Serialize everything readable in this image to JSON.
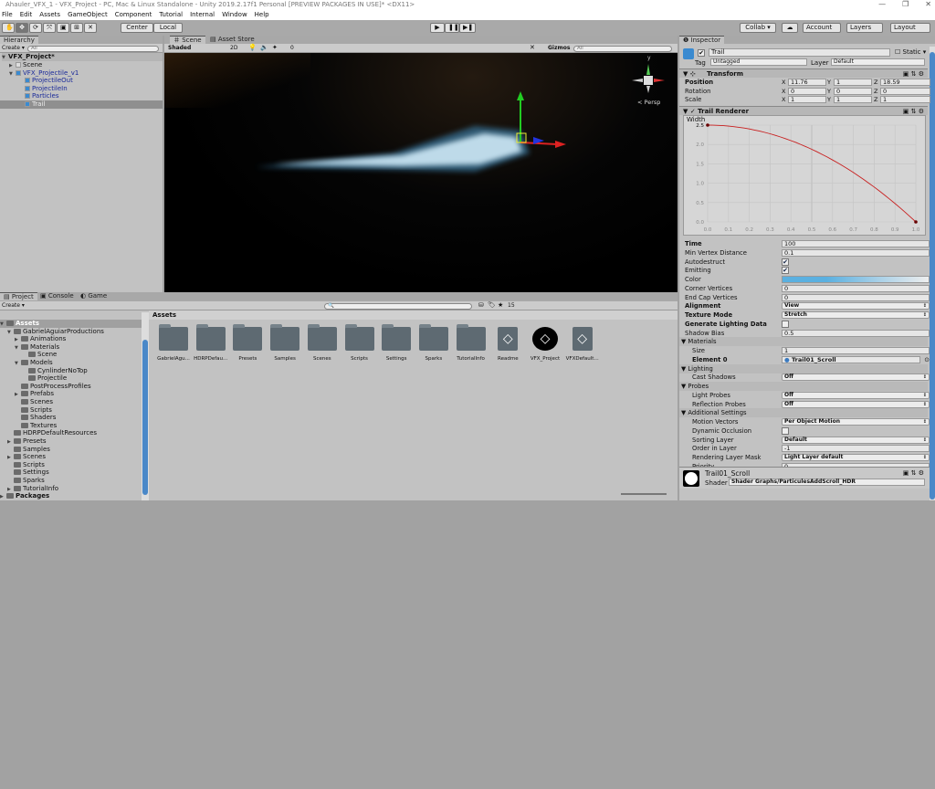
{
  "window": {
    "title": "Ahauler_VFX_1 - VFX_Project - PC, Mac & Linux Standalone - Unity 2019.2.17f1 Personal [PREVIEW PACKAGES IN USE]* <DX11>",
    "minimize": "—",
    "restore": "❐",
    "close": "✕"
  },
  "menu": [
    "File",
    "Edit",
    "Assets",
    "GameObject",
    "Component",
    "Tutorial",
    "Internal",
    "Window",
    "Help"
  ],
  "toolbar": {
    "tools": [
      "hand-tool",
      "move-tool",
      "rotate-tool",
      "scale-tool",
      "rect-tool",
      "transform-tool",
      "custom-tool"
    ],
    "tool_glyphs": [
      "✋",
      "✥",
      "⟳",
      "⤧",
      "▣",
      "⊞",
      "✕"
    ],
    "pivot": "Center",
    "space": "Local",
    "play": "▶",
    "pause": "❚❚",
    "step": "▶❚",
    "collab": "Collab ▾",
    "cloud": "☁",
    "account": "Account",
    "layers": "Layers",
    "layout": "Layout"
  },
  "hierarchy": {
    "tab": "Hierarchy",
    "create": "Create ▾",
    "search": "All",
    "scene": "VFX_Project*",
    "items": [
      {
        "label": "Scene",
        "depth": 1,
        "fold": "▶",
        "blue": false
      },
      {
        "label": "VFX_Projectile_v1",
        "depth": 1,
        "fold": "▼",
        "blue": true
      },
      {
        "label": "ProjectileOut",
        "depth": 2,
        "fold": "",
        "blue": true
      },
      {
        "label": "ProjectileIn",
        "depth": 2,
        "fold": "",
        "blue": true
      },
      {
        "label": "Particles",
        "depth": 2,
        "fold": "",
        "blue": true
      },
      {
        "label": "Trail",
        "depth": 2,
        "fold": "",
        "blue": true,
        "selected": true
      }
    ]
  },
  "scene": {
    "tabs": [
      "Scene",
      "Asset Store"
    ],
    "shading": "Shaded",
    "mode2d": "2D",
    "gizmos": "Gizmos",
    "search": "All",
    "hidden_count": "0",
    "persp": "< Persp",
    "axis_y": "y"
  },
  "project": {
    "tabs": [
      "Project",
      "Console",
      "Game"
    ],
    "create": "Create ▾",
    "breadcrumb": "Assets",
    "hidden_count": "15",
    "tree": [
      {
        "label": "Assets",
        "depth": 0,
        "fold": "▼",
        "bold": true,
        "selected": true
      },
      {
        "label": "GabrielAguiarProductions",
        "depth": 1,
        "fold": "▼"
      },
      {
        "label": "Animations",
        "depth": 2,
        "fold": "▶"
      },
      {
        "label": "Materials",
        "depth": 2,
        "fold": "▼"
      },
      {
        "label": "Scene",
        "depth": 3,
        "fold": ""
      },
      {
        "label": "Models",
        "depth": 2,
        "fold": "▼"
      },
      {
        "label": "CynlinderNoTop",
        "depth": 3,
        "fold": ""
      },
      {
        "label": "Projectile",
        "depth": 3,
        "fold": ""
      },
      {
        "label": "PostProcessProfiles",
        "depth": 2,
        "fold": ""
      },
      {
        "label": "Prefabs",
        "depth": 2,
        "fold": "▶"
      },
      {
        "label": "Scenes",
        "depth": 2,
        "fold": ""
      },
      {
        "label": "Scripts",
        "depth": 2,
        "fold": ""
      },
      {
        "label": "Shaders",
        "depth": 2,
        "fold": ""
      },
      {
        "label": "Textures",
        "depth": 2,
        "fold": ""
      },
      {
        "label": "HDRPDefaultResources",
        "depth": 1,
        "fold": ""
      },
      {
        "label": "Presets",
        "depth": 1,
        "fold": "▶"
      },
      {
        "label": "Samples",
        "depth": 1,
        "fold": ""
      },
      {
        "label": "Scenes",
        "depth": 1,
        "fold": "▶"
      },
      {
        "label": "Scripts",
        "depth": 1,
        "fold": ""
      },
      {
        "label": "Settings",
        "depth": 1,
        "fold": ""
      },
      {
        "label": "Sparks",
        "depth": 1,
        "fold": ""
      },
      {
        "label": "TutorialInfo",
        "depth": 1,
        "fold": "▶"
      },
      {
        "label": "Packages",
        "depth": 0,
        "fold": "▶",
        "bold": true
      }
    ],
    "assets": [
      {
        "label": "GabrielAgu...",
        "type": "folder"
      },
      {
        "label": "HDRPDefau...",
        "type": "folder"
      },
      {
        "label": "Presets",
        "type": "folder"
      },
      {
        "label": "Samples",
        "type": "folder"
      },
      {
        "label": "Scenes",
        "type": "folder"
      },
      {
        "label": "Scripts",
        "type": "folder"
      },
      {
        "label": "Settings",
        "type": "folder"
      },
      {
        "label": "Sparks",
        "type": "folder"
      },
      {
        "label": "TutorialInfo",
        "type": "folder"
      },
      {
        "label": "Readme",
        "type": "unity-asset"
      },
      {
        "label": "VFX_Project",
        "type": "unity-scene"
      },
      {
        "label": "VFXDefault...",
        "type": "unity-asset"
      }
    ]
  },
  "inspector": {
    "tab": "Inspector",
    "name": "Trail",
    "static": "Static",
    "tag_label": "Tag",
    "tag": "Untagged",
    "layer_label": "Layer",
    "layer": "Default",
    "transform": {
      "title": "Transform",
      "rows": [
        {
          "label": "Position",
          "x": "11.76",
          "y": "1",
          "z": "18.59"
        },
        {
          "label": "Rotation",
          "x": "0",
          "y": "0",
          "z": "0"
        },
        {
          "label": "Scale",
          "x": "1",
          "y": "1",
          "z": "1"
        }
      ]
    },
    "trail": {
      "title": "Trail Renderer",
      "width_label": "Width",
      "width_value": "2.5",
      "curve": {
        "x_ticks": [
          "0.0",
          "0.1",
          "0.2",
          "0.3",
          "0.4",
          "0.5",
          "0.6",
          "0.7",
          "0.8",
          "0.9",
          "1.0"
        ],
        "y_ticks": [
          "0.0",
          "0.5",
          "1.0",
          "1.5",
          "2.0",
          "2.5"
        ],
        "keys": [
          {
            "time": 0,
            "value": 2.5
          },
          {
            "time": 1,
            "value": 0
          }
        ],
        "color": "#c81e1e"
      },
      "rows": [
        {
          "label": "Time",
          "value": "100",
          "kind": "field",
          "bold": true
        },
        {
          "label": "Min Vertex Distance",
          "value": "0.1",
          "kind": "field"
        },
        {
          "label": "Autodestruct",
          "value": "✔",
          "kind": "check"
        },
        {
          "label": "Emitting",
          "value": "✔",
          "kind": "check"
        },
        {
          "label": "Color",
          "value": "",
          "kind": "gradient"
        },
        {
          "label": "Corner Vertices",
          "value": "0",
          "kind": "field"
        },
        {
          "label": "End Cap Vertices",
          "value": "0",
          "kind": "field"
        },
        {
          "label": "Alignment",
          "value": "View",
          "kind": "dropdown",
          "bold": true
        },
        {
          "label": "Texture Mode",
          "value": "Stretch",
          "kind": "dropdown",
          "bold": true
        },
        {
          "label": "Generate Lighting Data",
          "value": "",
          "kind": "check",
          "bold": true
        },
        {
          "label": "Shadow Bias",
          "value": "0.5",
          "kind": "field"
        },
        {
          "label": "Materials",
          "kind": "section"
        },
        {
          "label": "Size",
          "value": "1",
          "kind": "field",
          "indent": true
        },
        {
          "label": "Element 0",
          "value": "Trail01_Scroll",
          "kind": "object",
          "bold": true,
          "indent": true
        },
        {
          "label": "Lighting",
          "kind": "section"
        },
        {
          "label": "Cast Shadows",
          "value": "Off",
          "kind": "dropdown",
          "indent": true
        },
        {
          "label": "Probes",
          "kind": "section"
        },
        {
          "label": "Light Probes",
          "value": "Off",
          "kind": "dropdown",
          "indent": true
        },
        {
          "label": "Reflection Probes",
          "value": "Off",
          "kind": "dropdown",
          "indent": true
        },
        {
          "label": "Additional Settings",
          "kind": "section"
        },
        {
          "label": "Motion Vectors",
          "value": "Per Object Motion",
          "kind": "dropdown",
          "indent": true
        },
        {
          "label": "Dynamic Occlusion",
          "value": "",
          "kind": "check",
          "indent": true
        },
        {
          "label": "Sorting Layer",
          "value": "Default",
          "kind": "dropdown",
          "indent": true
        },
        {
          "label": "Order in Layer",
          "value": "-1",
          "kind": "field",
          "indent": true
        },
        {
          "label": "Rendering Layer Mask",
          "value": "Light Layer default",
          "kind": "dropdown",
          "indent": true
        },
        {
          "label": "Priority",
          "value": "0",
          "kind": "field",
          "indent": true
        }
      ]
    },
    "material": {
      "name": "Trail01_Scroll",
      "shader_label": "Shader",
      "shader": "Shader Graphs/ParticulesAddScroll_HDR"
    }
  },
  "colors": {
    "accent_selection": "#3e7ce0",
    "panel": "#c2c2c2",
    "scene_bg": "#000000",
    "trail_glow": "#bfe8ff"
  }
}
